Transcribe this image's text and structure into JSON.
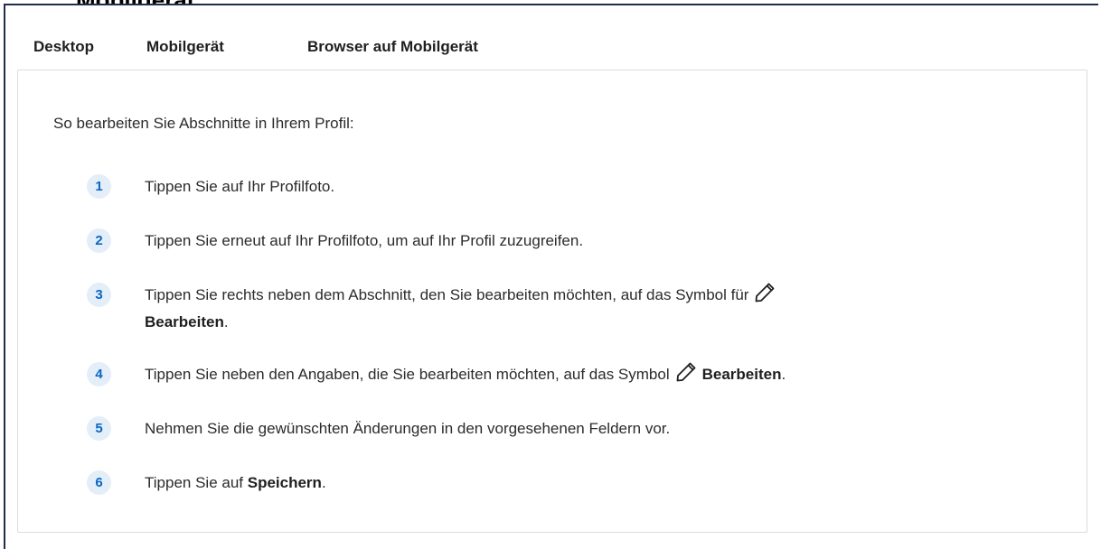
{
  "heading": "Mobilgerät",
  "tabs": [
    {
      "label": "Desktop",
      "active": false
    },
    {
      "label": "Mobilgerät",
      "active": true
    },
    {
      "label": "Browser auf Mobilgerät",
      "active": false
    }
  ],
  "intro": "So bearbeiten Sie Abschnitte in Ihrem Profil:",
  "steps": [
    {
      "number": "1",
      "text": "Tippen Sie auf Ihr Profilfoto."
    },
    {
      "number": "2",
      "text": "Tippen Sie erneut auf Ihr Profilfoto, um auf Ihr Profil zuzugreifen."
    },
    {
      "number": "3",
      "text_before": "Tippen Sie rechts neben dem Abschnitt, den Sie bearbeiten möchten, auf das Symbol für",
      "bold": "Bearbeiten",
      "text_after": "."
    },
    {
      "number": "4",
      "text_before": "Tippen Sie neben den Angaben, die Sie bearbeiten möchten, auf das Symbol",
      "bold": "Bearbeiten",
      "text_after": "."
    },
    {
      "number": "5",
      "text": "Nehmen Sie die gewünschten Änderungen in den vorgesehenen Feldern vor."
    },
    {
      "number": "6",
      "text_before": "Tippen Sie auf",
      "bold": "Speichern",
      "text_after": "."
    }
  ],
  "icons": {
    "edit": "pencil-icon"
  },
  "colors": {
    "accent": "#0a66c2",
    "badge_bg": "#e3eef8",
    "frame": "#1f2d4a"
  }
}
